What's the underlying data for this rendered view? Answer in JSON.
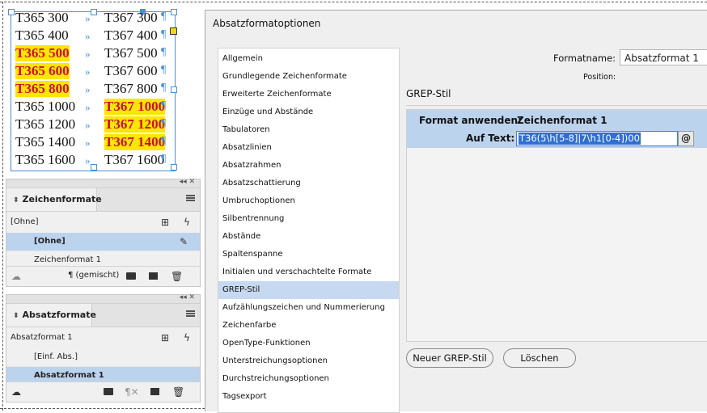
{
  "document": {
    "rows": [
      {
        "left": "T365 300",
        "arrow": "»",
        "right": "T367 300",
        "left_hl": false,
        "right_hl": false
      },
      {
        "left": "T365 400",
        "arrow": "»",
        "right": "T367 400",
        "left_hl": false,
        "right_hl": false
      },
      {
        "left": "T365 500",
        "arrow": "»",
        "right": "T367 500",
        "left_hl": true,
        "right_hl": false
      },
      {
        "left": "T365 600",
        "arrow": "»",
        "right": "T367 600",
        "left_hl": true,
        "right_hl": false
      },
      {
        "left": "T365 800",
        "arrow": "»",
        "right": "T367 800",
        "left_hl": true,
        "right_hl": false
      },
      {
        "left": "T365 1000",
        "arrow": "»",
        "right": "T367 1000",
        "left_hl": false,
        "right_hl": true
      },
      {
        "left": "T365 1200",
        "arrow": "»",
        "right": "T367 1200",
        "left_hl": false,
        "right_hl": true
      },
      {
        "left": "T365 1400",
        "arrow": "»",
        "right": "T367 1400",
        "left_hl": false,
        "right_hl": true
      },
      {
        "left": "T365 1600",
        "arrow": "»",
        "right": "T367 1600",
        "left_hl": false,
        "right_hl": false
      }
    ],
    "pilcrow": "¶",
    "highlight_color": "#ffe600",
    "highlight_text_color": "#c8102e"
  },
  "zeichenformate": {
    "title": "Zeichenformate",
    "current": "[Ohne]",
    "items": [
      {
        "label": "[Ohne]"
      },
      {
        "label": "Zeichenformat 1"
      }
    ],
    "footer_label": "¶ (gemischt)"
  },
  "absatzformate": {
    "title": "Absatzformate",
    "current": "Absatzformat 1",
    "items": [
      {
        "label": "[Einf. Abs.]"
      },
      {
        "label": "Absatzformat 1"
      }
    ]
  },
  "dialog": {
    "title": "Absatzformatoptionen",
    "format_name_label": "Formatname:",
    "format_name_value": "Absatzformat 1",
    "position_label": "Position:",
    "section_title": "GREP-Stil",
    "nav": [
      "Allgemein",
      "Grundlegende Zeichenformate",
      "Erweiterte Zeichenformate",
      "Einzüge und Abstände",
      "Tabulatoren",
      "Absatzlinien",
      "Absatzrahmen",
      "Absatzschattierung",
      "Umbruchoptionen",
      "Silbentrennung",
      "Abstände",
      "Spaltenspanne",
      "Initialen und verschachtelte Formate",
      "GREP-Stil",
      "Aufzählungszeichen und Nummerierung",
      "Zeichenfarbe",
      "OpenType-Funktionen",
      "Unterstreichungsoptionen",
      "Durchstreichungsoptionen",
      "Tagsexport"
    ],
    "selected_nav": "GREP-Stil",
    "rule": {
      "apply_label": "Format anwenden:",
      "apply_value": "Zeichenformat 1",
      "text_label": "Auf Text:",
      "text_value": "T36(5\\h[5-8]|7\\h1[0-4])00"
    },
    "new_button": "Neuer GREP-Stil",
    "delete_button": "Löschen"
  },
  "colors": {
    "accent": "#4a90d9",
    "selection": "#bcd3ee"
  }
}
